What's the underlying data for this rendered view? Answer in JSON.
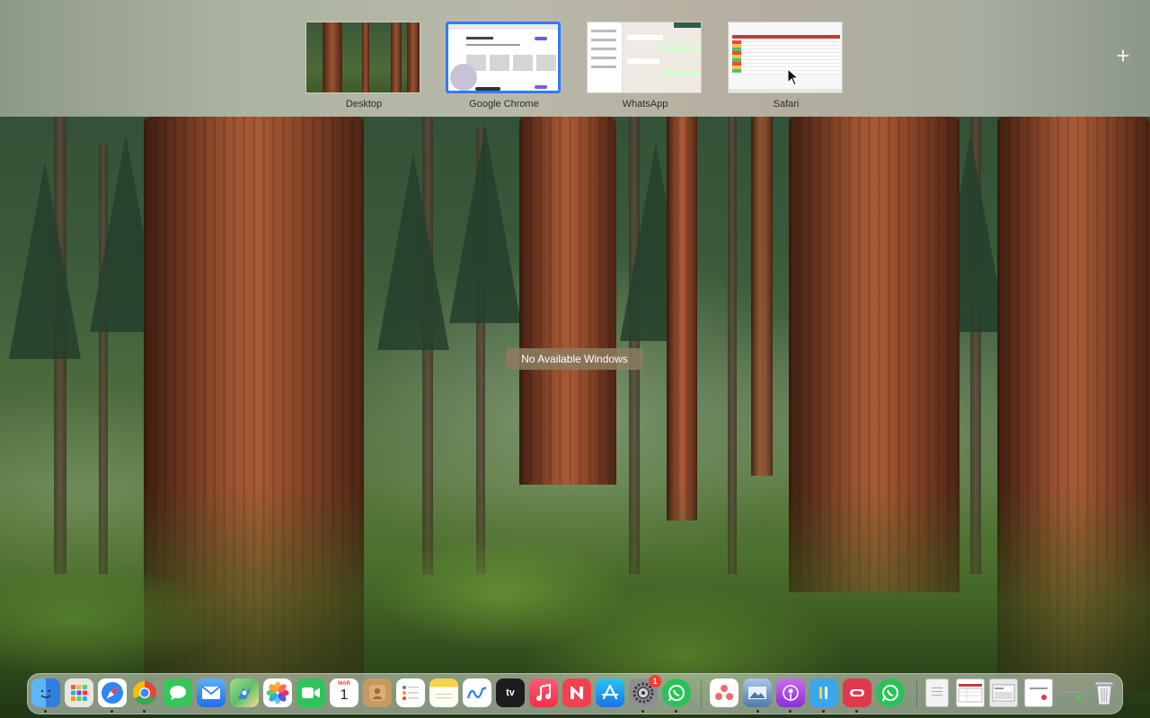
{
  "spaces": [
    {
      "label": "Desktop",
      "selected": false
    },
    {
      "label": "Google Chrome",
      "selected": true
    },
    {
      "label": "WhatsApp",
      "selected": false
    },
    {
      "label": "Safari",
      "selected": false
    }
  ],
  "add_space_glyph": "+",
  "message": "No Available Windows",
  "dock": {
    "apps": [
      {
        "name": "finder-icon",
        "color": "#3d8ef0",
        "running": true
      },
      {
        "name": "launchpad-icon",
        "color": "#e9e6e0",
        "running": false
      },
      {
        "name": "safari-icon",
        "color": "#2f86f6",
        "running": true
      },
      {
        "name": "chrome-icon",
        "color": "#ffffff",
        "running": true
      },
      {
        "name": "messages-icon",
        "color": "#34c759",
        "running": false
      },
      {
        "name": "mail-icon",
        "color": "#3b8cf5",
        "running": false
      },
      {
        "name": "maps-icon",
        "color": "#5fbf6a",
        "running": false
      },
      {
        "name": "photos-icon",
        "color": "#ffffff",
        "running": false
      },
      {
        "name": "facetime-icon",
        "color": "#2fc459",
        "running": false
      },
      {
        "name": "calendar-icon",
        "color": "#ffffff",
        "running": false
      },
      {
        "name": "contacts-icon",
        "color": "#c8995e",
        "running": false
      },
      {
        "name": "reminders-icon",
        "color": "#ffffff",
        "running": false
      },
      {
        "name": "notes-icon",
        "color": "#f7d34a",
        "running": false
      },
      {
        "name": "freeform-icon",
        "color": "#ffffff",
        "running": false
      },
      {
        "name": "apple-tv-icon",
        "color": "#1c1c1e",
        "running": false
      },
      {
        "name": "music-icon",
        "color": "#fa3b5a",
        "running": false
      },
      {
        "name": "news-icon",
        "color": "#f1414e",
        "running": false
      },
      {
        "name": "app-store-icon",
        "color": "#2b8cf6",
        "running": false
      },
      {
        "name": "system-settings-icon",
        "color": "#8e8e93",
        "running": true
      },
      {
        "name": "whatsapp-icon",
        "color": "#29c25a",
        "running": true
      },
      {
        "name": "asana-icon",
        "color": "#ffffff",
        "running": false
      },
      {
        "name": "preview-icon",
        "color": "#6c8fb8",
        "running": true
      },
      {
        "name": "podcasts-icon",
        "color": "#a347e3",
        "running": true
      },
      {
        "name": "keeper-icon",
        "color": "#3aa7e8",
        "running": true
      },
      {
        "name": "edge-like-icon",
        "color": "#e0394b",
        "running": true
      },
      {
        "name": "whatsapp-alt-icon",
        "color": "#29c25a",
        "running": false
      }
    ],
    "settings_badge": "1",
    "calendar_month": "MAR",
    "calendar_day": "1",
    "tv_label": "tv"
  }
}
